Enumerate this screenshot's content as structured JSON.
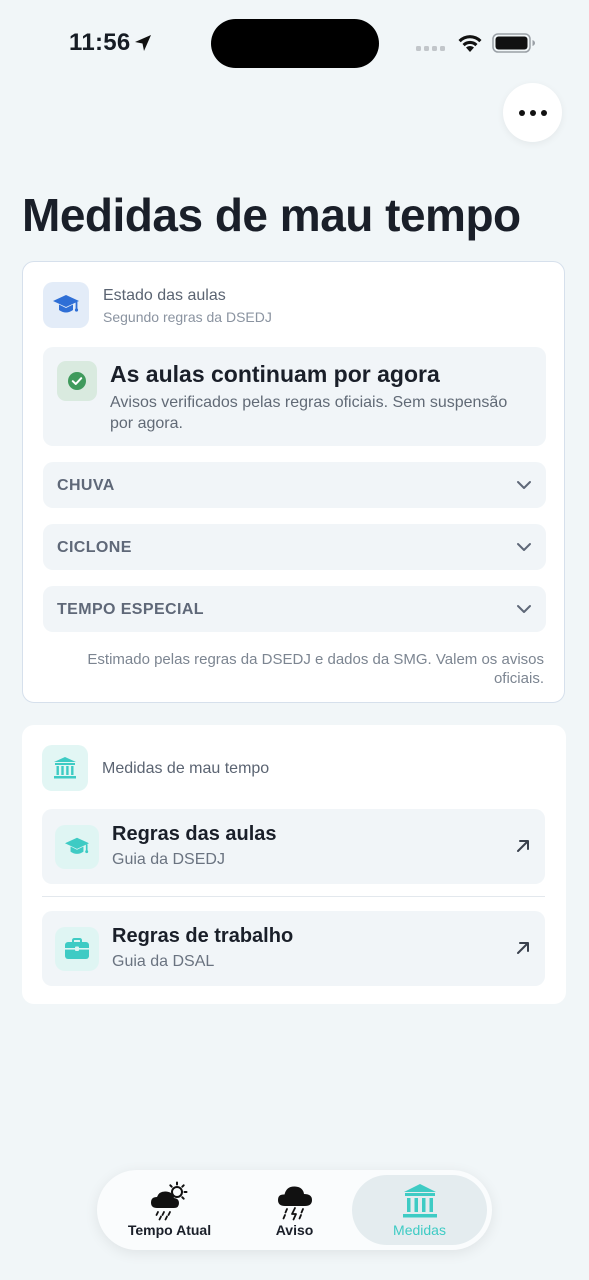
{
  "status_bar": {
    "time": "11:56"
  },
  "page": {
    "title": "Medidas de mau tempo"
  },
  "class_status": {
    "header_title": "Estado das aulas",
    "header_subtitle": "Segundo regras da DSEDJ",
    "status_title": "As aulas continuam por agora",
    "status_description": "Avisos verificados pelas regras oficiais. Sem suspensão por agora.",
    "sections": [
      {
        "label": "CHUVA"
      },
      {
        "label": "CICLONE"
      },
      {
        "label": "TEMPO ESPECIAL"
      }
    ],
    "footnote": "Estimado pelas regras da DSEDJ e dados da SMG. Valem os avisos oficiais."
  },
  "measures": {
    "header_title": "Medidas de mau tempo",
    "links": [
      {
        "title": "Regras das aulas",
        "subtitle": "Guia da DSEDJ",
        "icon": "graduation-cap-icon"
      },
      {
        "title": "Regras de trabalho",
        "subtitle": "Guia da DSAL",
        "icon": "briefcase-icon"
      }
    ]
  },
  "tab_bar": {
    "tabs": [
      {
        "label": "Tempo Atual",
        "icon": "sun-cloud-rain-icon",
        "active": false
      },
      {
        "label": "Aviso",
        "icon": "storm-cloud-icon",
        "active": false
      },
      {
        "label": "Medidas",
        "icon": "institution-icon",
        "active": true
      }
    ]
  },
  "colors": {
    "accent": "#3ecbc4",
    "primary_blue": "#2f6fd6",
    "success_green": "#3f9a5c",
    "background": "#f1f6f8"
  }
}
